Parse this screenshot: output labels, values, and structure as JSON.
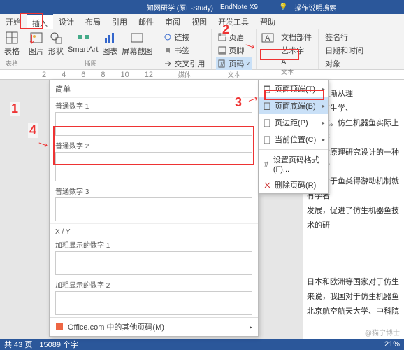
{
  "titlebar": {
    "app1": "知网研学 (原E-Study)",
    "app2": "EndNote X9",
    "search": "操作说明搜索"
  },
  "tabs": [
    "开始",
    "插入",
    "设计",
    "布局",
    "引用",
    "邮件",
    "审阅",
    "视图",
    "开发工具",
    "帮助"
  ],
  "ribbon": {
    "g1": "表格",
    "g1l": "表格",
    "g2a": "图片",
    "g2b": "形状",
    "g2c": "SmartArt",
    "g2d": "图表",
    "g2e": "屏幕截图",
    "g2l": "插图",
    "g3a": "链接",
    "g3b": "书签",
    "g3c": "交叉引用",
    "g3l": "媒体",
    "g4a": "页眉",
    "g4b": "页脚",
    "g4c": "页码",
    "g4l": "文本",
    "g5a": "文档部件",
    "g5b": "艺术字",
    "g5c": "A",
    "g5l": "文本",
    "g6a": "签名行",
    "g6b": "日期和时间",
    "g6c": "对象"
  },
  "dropdown": {
    "i1": "页面顶端(T)",
    "i2": "页面底端(B)",
    "i3": "页边距(P)",
    "i4": "当前位置(C)",
    "i5": "设置页码格式(F)...",
    "i6": "删除页码(R)"
  },
  "gallery": {
    "header": "简单",
    "it1": "普通数字 1",
    "it2": "普通数字 2",
    "it3": "普通数字 3",
    "sep": "X / Y",
    "it4": "加粗显示的数字 1",
    "it5": "加粗显示的数字 2",
    "footer": "Office.com 中的其他页码(M)"
  },
  "doc": {
    "l1": "主鱼逐渐从理",
    "l2": "是集仿生学、",
    "l3": "的研究。仿生机器鱼实际上是科研",
    "l4": "仿生学原理研究设计的一种基于仿",
    "l5": "期，对于鱼类得游动机制就有学者",
    "l6": "发展，促进了仿生机器鱼技术的研",
    "l7": "日本和欧洲等国家对于仿生",
    "l8": "来说，我国对于仿生机器鱼",
    "l9": "北京航空航天大学、中科院"
  },
  "status": {
    "left1": "共 43 页",
    "left2": "15089 个字",
    "zoom": "21%"
  },
  "watermark": "@猫宁博士",
  "marks": {
    "n1": "1",
    "n2": "2",
    "n3": "3",
    "n4": "4"
  }
}
